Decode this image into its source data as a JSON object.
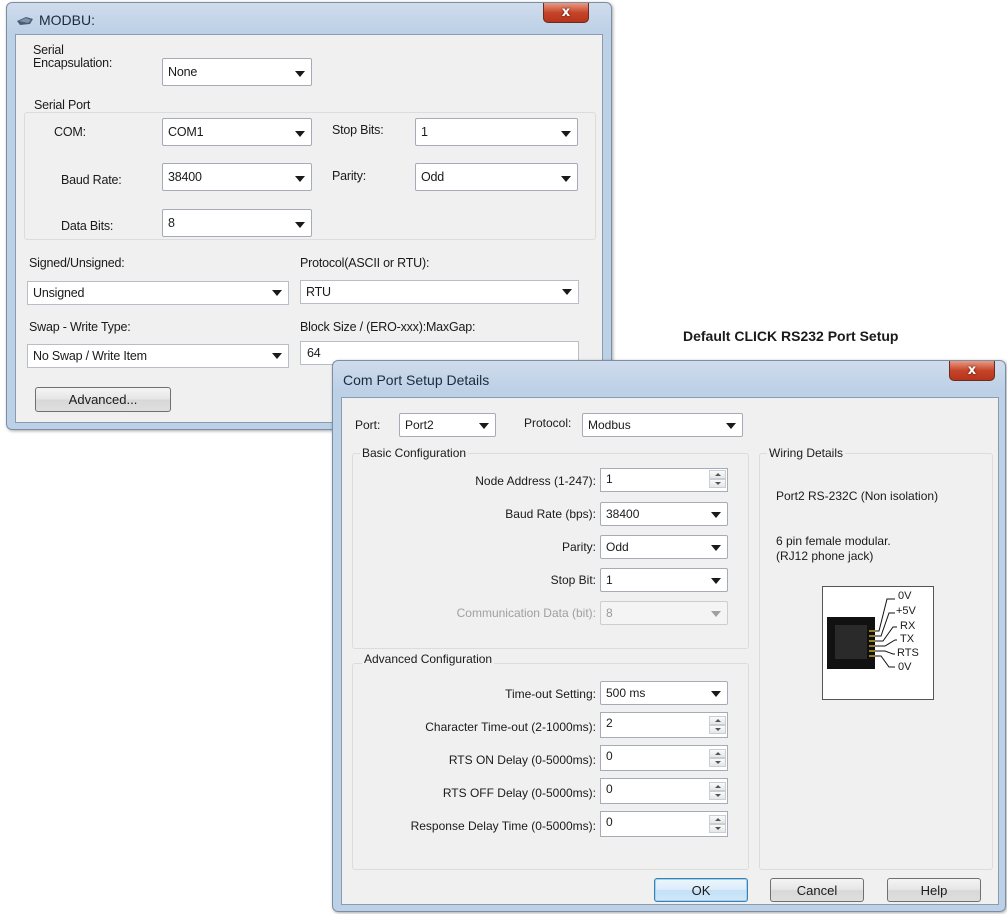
{
  "modbu": {
    "title": "MODBU:",
    "serial_encapsulation_label": "Serial Encapsulation:",
    "serial_encapsulation_value": "None",
    "serial_port_group": "Serial Port",
    "com_label": "COM:",
    "com_value": "COM1",
    "stop_bits_label": "Stop Bits:",
    "stop_bits_value": "1",
    "baud_rate_label": "Baud Rate:",
    "baud_rate_value": "38400",
    "parity_label": "Parity:",
    "parity_value": "Odd",
    "data_bits_label": "Data Bits:",
    "data_bits_value": "8",
    "signed_label": "Signed/Unsigned:",
    "signed_value": "Unsigned",
    "protocol_label": "Protocol(ASCII or RTU):",
    "protocol_value": "RTU",
    "swap_label": "Swap - Write Type:",
    "swap_value": "No Swap / Write Item",
    "block_size_label": "Block Size / (ERO-xxx):MaxGap:",
    "block_size_value": "64",
    "advanced_button": "Advanced...",
    "close_glyph": "x"
  },
  "caption": "Default CLICK RS232 Port Setup",
  "com": {
    "title": "Com Port Setup Details",
    "close_glyph": "x",
    "port_label": "Port:",
    "port_value": "Port2",
    "protocol_label": "Protocol:",
    "protocol_value": "Modbus",
    "basic_group": "Basic Configuration",
    "node_address_label": "Node Address (1-247):",
    "node_address_value": "1",
    "baud_label": "Baud Rate (bps):",
    "baud_value": "38400",
    "parity_label": "Parity:",
    "parity_value": "Odd",
    "stop_bit_label": "Stop Bit:",
    "stop_bit_value": "1",
    "comm_data_label": "Communication Data (bit):",
    "comm_data_value": "8",
    "advanced_group": "Advanced Configuration",
    "timeout_label": "Time-out Setting:",
    "timeout_value": "500 ms",
    "char_timeout_label": "Character Time-out (2-1000ms):",
    "char_timeout_value": "2",
    "rts_on_label": "RTS ON Delay (0-5000ms):",
    "rts_on_value": "0",
    "rts_off_label": "RTS OFF Delay (0-5000ms):",
    "rts_off_value": "0",
    "response_label": "Response Delay Time (0-5000ms):",
    "response_value": "0",
    "wiring_group": "Wiring Details",
    "wiring_port": "Port2 RS-232C (Non isolation)",
    "wiring_desc_1": "6 pin female modular.",
    "wiring_desc_2": "(RJ12 phone jack)",
    "pins": [
      "0V",
      "+5V",
      "RX",
      "TX",
      "RTS",
      "0V"
    ],
    "ok_button": "OK",
    "cancel_button": "Cancel",
    "help_button": "Help"
  }
}
